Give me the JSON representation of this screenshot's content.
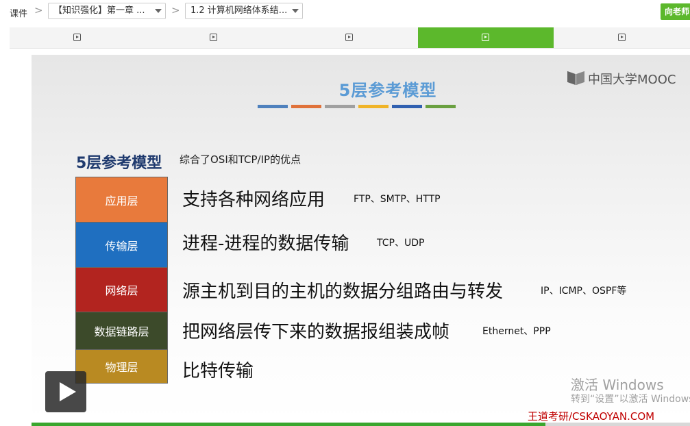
{
  "breadcrumb": {
    "root": "课件",
    "separator": ">",
    "chapter_select": "【知识强化】第一章 ...",
    "lesson_select": "1.2 计算机网络体系结..."
  },
  "teacher_button": "向老师",
  "unit_tabs": [
    {
      "icon": "video-play-icon",
      "active": false
    },
    {
      "icon": "video-play-icon",
      "active": false
    },
    {
      "icon": "video-play-icon",
      "active": false
    },
    {
      "icon": "video-play-icon",
      "active": true
    },
    {
      "icon": "video-play-icon",
      "active": false
    }
  ],
  "slide": {
    "title": "5层参考模型",
    "logo_text": "中国大学MOOC",
    "title_bar_colors": [
      "#4f81bd",
      "#e0723a",
      "#a0a0a0",
      "#f0b428",
      "#3060b0",
      "#6aa040"
    ],
    "heading": "5层参考模型",
    "subheading": "综合了OSI和TCP/IP的优点",
    "layers": [
      {
        "name": "应用层",
        "color": "#e87a3c",
        "description": "支持各种网络应用",
        "protocols": "FTP、SMTP、HTTP"
      },
      {
        "name": "传输层",
        "color": "#1f6fc0",
        "description": "进程-进程的数据传输",
        "protocols": "TCP、UDP"
      },
      {
        "name": "网络层",
        "color": "#b2241f",
        "description": "源主机到目的主机的数据分组路由与转发",
        "protocols": "IP、ICMP、OSPF等"
      },
      {
        "name": "数据链路层",
        "color": "#3c4a2a",
        "description": "把网络层传下来的数据报组装成帧",
        "protocols": "Ethernet、PPP"
      },
      {
        "name": "物理层",
        "color": "#b98a22",
        "description": "比特传输",
        "protocols": ""
      }
    ],
    "activate_title": "激活 Windows",
    "activate_sub": "转到“设置”以激活 Windows。",
    "watermark": "王道考研/CSKAOYAN.COM"
  },
  "player": {
    "play_icon": "play-icon",
    "progress": 0.78
  },
  "colors": {
    "accent_green": "#5cb82c",
    "title_blue": "#5b9bd5",
    "heading_navy": "#1f3a6e",
    "watermark_red": "#c00000"
  }
}
